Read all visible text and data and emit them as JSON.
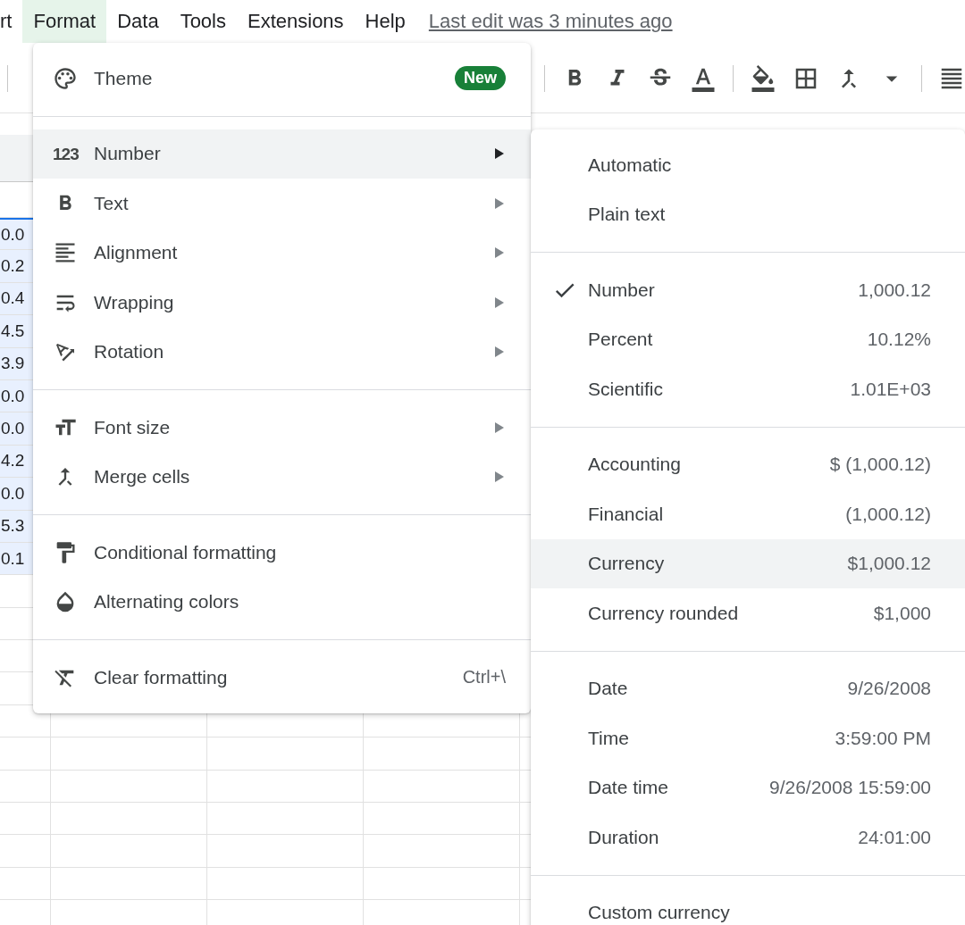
{
  "menu_bar": {
    "items": [
      {
        "label": "rt",
        "selected": false
      },
      {
        "label": "Format",
        "selected": true
      },
      {
        "label": "Data",
        "selected": false
      },
      {
        "label": "Tools",
        "selected": false
      },
      {
        "label": "Extensions",
        "selected": false
      },
      {
        "label": "Help",
        "selected": false
      }
    ],
    "last_edit": "Last edit was 3 minutes ago"
  },
  "sheet": {
    "cells": [
      {
        "value": "0.0",
        "selected": true
      },
      {
        "value": "0.2",
        "selected": true
      },
      {
        "value": "0.4",
        "selected": true
      },
      {
        "value": "4.5",
        "selected": true
      },
      {
        "value": "3.9",
        "selected": true
      },
      {
        "value": "0.0",
        "selected": true
      },
      {
        "value": "0.0",
        "selected": true
      },
      {
        "value": "4.2",
        "selected": true
      },
      {
        "value": "0.0",
        "selected": true
      },
      {
        "value": "5.3",
        "selected": true
      },
      {
        "value": "0.1",
        "selected": true
      }
    ]
  },
  "format_menu": {
    "sections": [
      {
        "items": [
          {
            "label": "Theme",
            "badge": "New",
            "submenu": false,
            "selected": false
          }
        ]
      },
      {
        "items": [
          {
            "label": "Number",
            "glyph": "123",
            "submenu": true,
            "selected": true
          },
          {
            "label": "Text",
            "submenu": true,
            "selected": false
          },
          {
            "label": "Alignment",
            "submenu": true,
            "selected": false
          },
          {
            "label": "Wrapping",
            "submenu": true,
            "selected": false
          },
          {
            "label": "Rotation",
            "submenu": true,
            "selected": false
          }
        ]
      },
      {
        "items": [
          {
            "label": "Font size",
            "submenu": true,
            "selected": false
          },
          {
            "label": "Merge cells",
            "submenu": true,
            "selected": false
          }
        ]
      },
      {
        "items": [
          {
            "label": "Conditional formatting",
            "submenu": false,
            "selected": false
          },
          {
            "label": "Alternating colors",
            "submenu": false,
            "selected": false
          }
        ]
      },
      {
        "items": [
          {
            "label": "Clear formatting",
            "shortcut": "Ctrl+\\",
            "submenu": false,
            "selected": false
          }
        ]
      }
    ]
  },
  "number_submenu": {
    "sections": [
      {
        "items": [
          {
            "label": "Automatic",
            "checked": false,
            "selected": false
          },
          {
            "label": "Plain text",
            "checked": false,
            "selected": false
          }
        ]
      },
      {
        "items": [
          {
            "label": "Number",
            "example": "1,000.12",
            "checked": true,
            "selected": false
          },
          {
            "label": "Percent",
            "example": "10.12%",
            "checked": false,
            "selected": false
          },
          {
            "label": "Scientific",
            "example": "1.01E+03",
            "checked": false,
            "selected": false
          }
        ]
      },
      {
        "items": [
          {
            "label": "Accounting",
            "example": "$ (1,000.12)",
            "checked": false,
            "selected": false
          },
          {
            "label": "Financial",
            "example": "(1,000.12)",
            "checked": false,
            "selected": false
          },
          {
            "label": "Currency",
            "example": "$1,000.12",
            "checked": false,
            "selected": true
          },
          {
            "label": "Currency rounded",
            "example": "$1,000",
            "checked": false,
            "selected": false
          }
        ]
      },
      {
        "items": [
          {
            "label": "Date",
            "example": "9/26/2008",
            "checked": false,
            "selected": false
          },
          {
            "label": "Time",
            "example": "3:59:00 PM",
            "checked": false,
            "selected": false
          },
          {
            "label": "Date time",
            "example": "9/26/2008 15:59:00",
            "checked": false,
            "selected": false
          },
          {
            "label": "Duration",
            "example": "24:01:00",
            "checked": false,
            "selected": false
          }
        ]
      },
      {
        "items": [
          {
            "label": "Custom currency",
            "checked": false,
            "selected": false
          }
        ]
      }
    ]
  }
}
